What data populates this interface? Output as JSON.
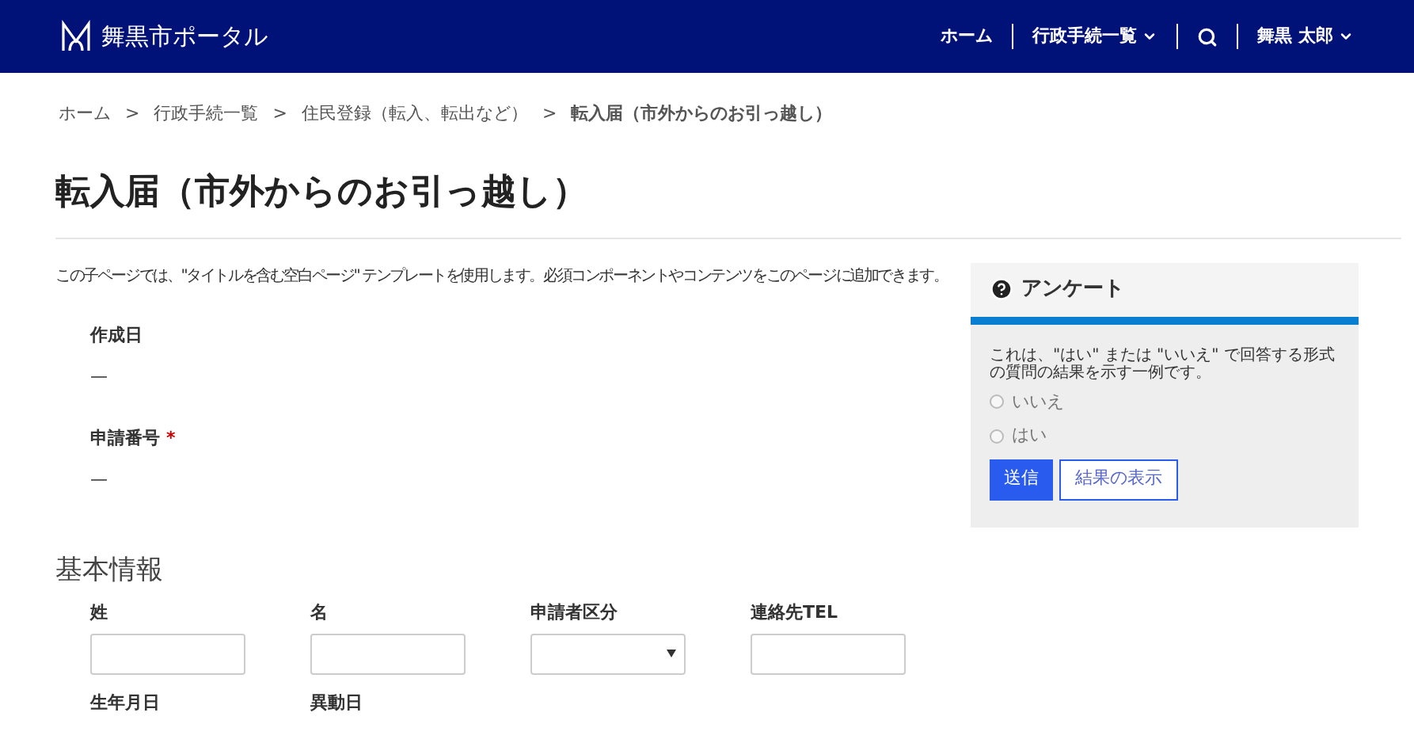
{
  "header": {
    "logo_text": "舞黒市ポータル",
    "nav": [
      {
        "label": "ホーム",
        "dropdown": false
      },
      {
        "label": "行政手続一覧",
        "dropdown": true
      },
      {
        "label": "舞黒 太郎",
        "dropdown": true
      }
    ]
  },
  "breadcrumb": {
    "links": [
      "ホーム",
      "行政手続一覧",
      "住民登録（転入、転出など）"
    ],
    "separator": ">",
    "current": "転入届（市外からのお引っ越し）"
  },
  "title": "転入届（市外からのお引っ越し）",
  "description": "この子ページでは、\"タイトルを含む空白ページ\" テンプレートを使用します。必須コンポーネントやコンテンツをこのページに追加できます。",
  "required_mark": "*",
  "info_fields": [
    {
      "label": "作成日",
      "value": "—",
      "required": false
    },
    {
      "label": "申請番号",
      "value": "—",
      "required": true
    }
  ],
  "section_title": "基本情報",
  "form_rows": [
    [
      {
        "label": "姓",
        "kind": "text"
      },
      {
        "label": "名",
        "kind": "text"
      },
      {
        "label": "申請者区分",
        "kind": "select"
      },
      {
        "label": "連絡先TEL",
        "kind": "text"
      }
    ],
    [
      {
        "label": "生年月日",
        "kind": "label"
      },
      {
        "label": "異動日",
        "kind": "label"
      }
    ]
  ],
  "survey": {
    "title": "アンケート",
    "question": "これは、\"はい\" または \"いいえ\" で回答する形式の質問の結果を示す一例です。",
    "options": [
      {
        "label": "いいえ",
        "selected": false
      },
      {
        "label": "はい",
        "selected": false
      }
    ],
    "submit": "送信",
    "results": "結果の表示"
  }
}
